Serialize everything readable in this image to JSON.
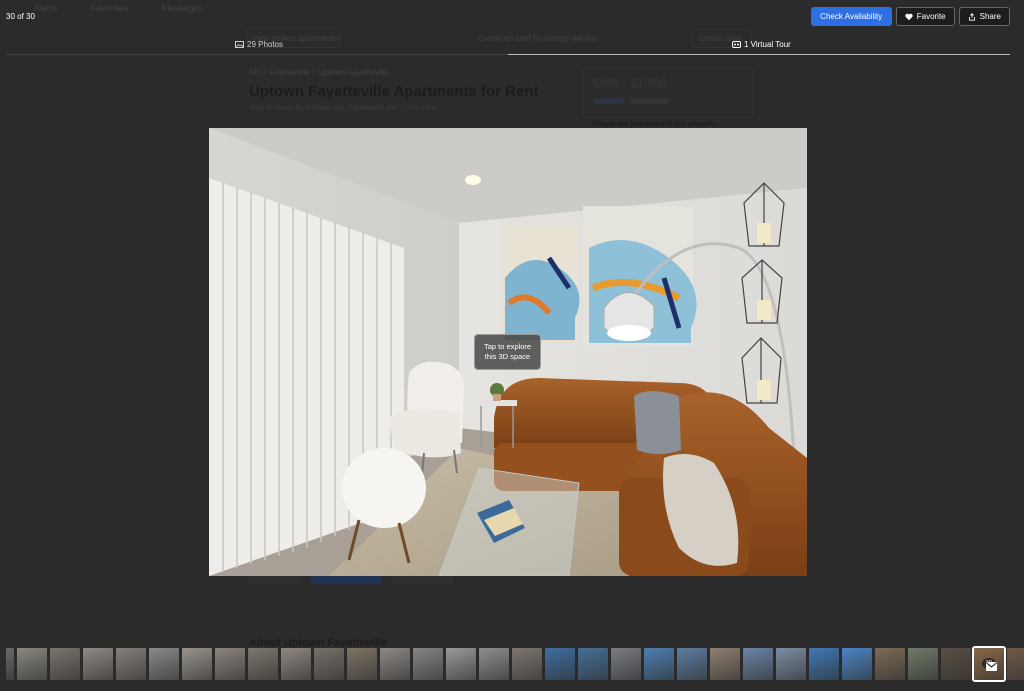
{
  "background_page": {
    "nav_items": [
      "Alerts",
      "Favorites",
      "Messages"
    ],
    "view_photos_label": "View photos apartments",
    "alert_text": "Create an alert for listings like this",
    "create_alert_label": "Create alert",
    "breadcrumb": "AR > Fayetteville > Uptown Fayetteville",
    "title": "Uptown Fayetteville Apartments for Rent",
    "address": "3559 N Steele Blvd #Suite 102, Fayetteville, AR 72703, USA",
    "price": "$895 - $1,950",
    "people_interested": "People are interested in this property",
    "about_heading": "About Uptown Fayetteville"
  },
  "viewer": {
    "counter": "30 of 30",
    "check_availability": "Check Availability",
    "favorite": "Favorite",
    "share": "Share",
    "tabs": [
      {
        "label": "29 Photos",
        "icon": "photo-icon",
        "active": false
      },
      {
        "label": "1 Virtual Tour",
        "icon": "virtual-tour-icon",
        "active": true
      }
    ],
    "tooltip": {
      "line1": "Tap to explore",
      "line2": "this 3D space"
    },
    "thumb_3d_label": "3D"
  },
  "filmstrip": {
    "thumb_colors": [
      "#6a6a6a",
      "#8b8780",
      "#7a746c",
      "#908a84",
      "#86807a",
      "#8a8a88",
      "#9a948c",
      "#8c857d",
      "#7d786f",
      "#8f8880",
      "#76706a",
      "#7e7465",
      "#8d8985",
      "#868686",
      "#9a9a9a",
      "#8f8f8f",
      "#7e7770",
      "#3f6fa0",
      "#456f99",
      "#7a7c82",
      "#4e7fb3",
      "#5c7da1",
      "#8f8070",
      "#6b85a8",
      "#7d8ea5",
      "#3f79b5",
      "#4b86c4",
      "#7c6a56",
      "#707a68",
      "#5a4f44",
      "#8a6848",
      "#6f5a4a"
    ],
    "active_index": 30
  },
  "colors": {
    "accent": "#2f6fe4"
  }
}
